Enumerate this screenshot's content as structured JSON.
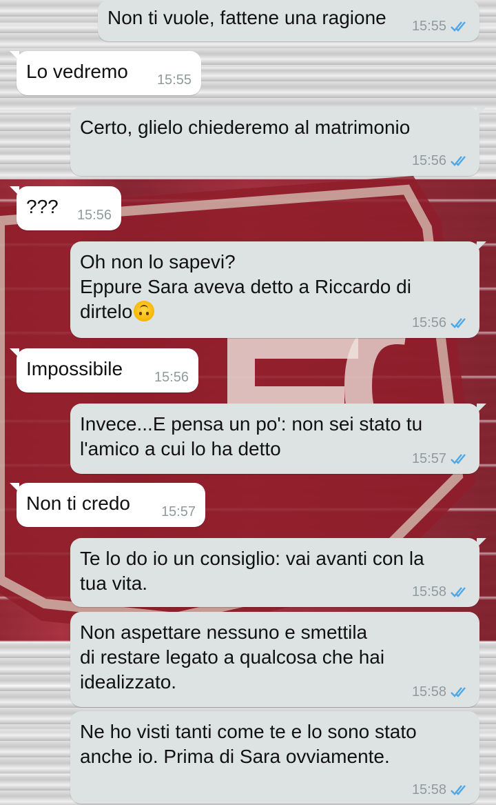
{
  "colors": {
    "outgoing_bubble": "#dde3e3",
    "incoming_bubble": "#ffffff",
    "read_ticks": "#4fa8e8",
    "timestamp": "#8f9b9b",
    "wallpaper_red": "#8e1b28"
  },
  "messages": [
    {
      "direction": "out",
      "text": "Non ti vuole, fattene una ragione",
      "time": "15:55",
      "status_icon": "double-check-read-icon"
    },
    {
      "direction": "in",
      "text": "Lo vedremo",
      "time": "15:55"
    },
    {
      "direction": "out",
      "text": "Certo, glielo chiederemo al matrimonio",
      "time": "15:56",
      "status_icon": "double-check-read-icon"
    },
    {
      "direction": "in",
      "text": "???",
      "time": "15:56"
    },
    {
      "direction": "out",
      "lines": [
        "Oh non lo sapevi?",
        "Eppure Sara aveva detto a Riccardo di",
        "dirtelo"
      ],
      "emoji": "upside-down-face-emoji",
      "time": "15:56",
      "status_icon": "double-check-read-icon"
    },
    {
      "direction": "in",
      "text": "Impossibile",
      "time": "15:56"
    },
    {
      "direction": "out",
      "lines": [
        "Invece...E pensa un po': non sei stato tu",
        "l'amico a cui lo ha detto"
      ],
      "time": "15:57",
      "status_icon": "double-check-read-icon"
    },
    {
      "direction": "in",
      "text": "Non ti credo",
      "time": "15:57"
    },
    {
      "direction": "out",
      "lines": [
        "Te lo do io un consiglio: vai avanti con la",
        "tua vita."
      ],
      "time": "15:58",
      "status_icon": "double-check-read-icon"
    },
    {
      "direction": "out",
      "lines": [
        "Non aspettare nessuno e smettila",
        "di restare legato a qualcosa che hai",
        "idealizzato."
      ],
      "time": "15:58",
      "status_icon": "double-check-read-icon"
    },
    {
      "direction": "out",
      "lines": [
        "Ne ho visti tanti come te e lo sono stato",
        "anche io. Prima di Sara ovviamente."
      ],
      "time": "15:58",
      "status_icon": "double-check-read-icon"
    }
  ]
}
